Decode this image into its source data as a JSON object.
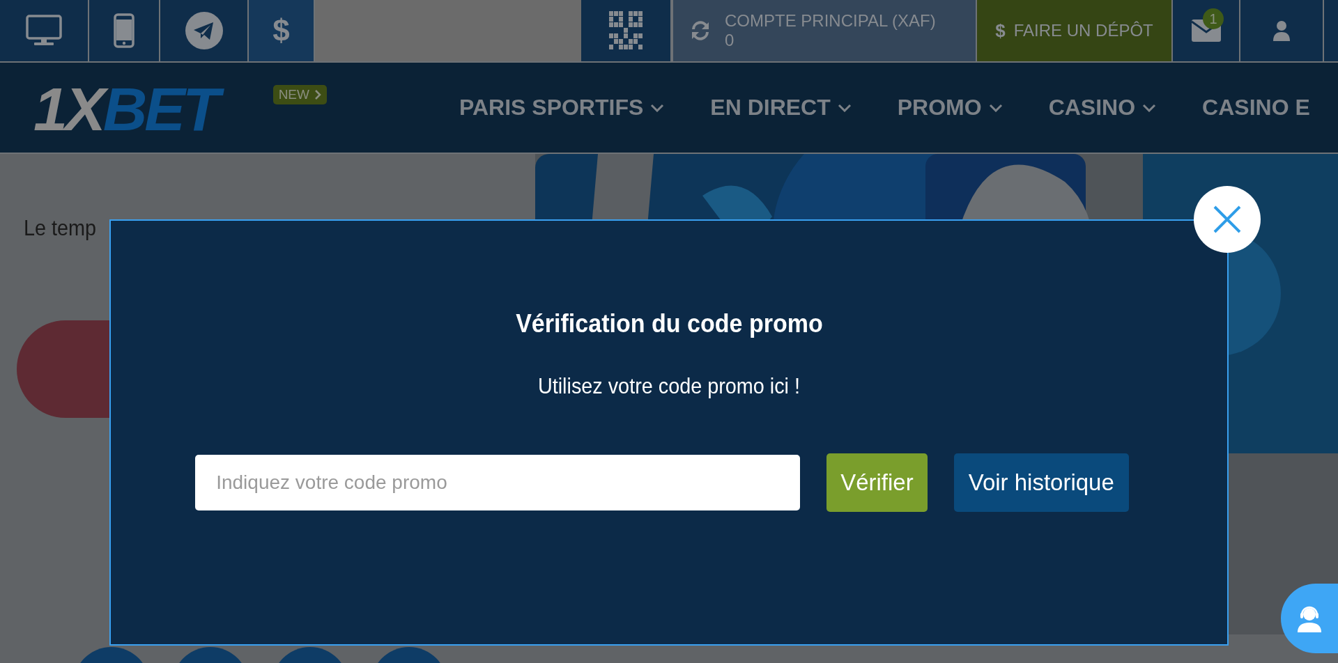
{
  "top_bar": {
    "quick_links": [
      {
        "kind": "desktop",
        "selected": false
      },
      {
        "kind": "mobile",
        "selected": false
      },
      {
        "kind": "telegram",
        "selected": false
      },
      {
        "kind": "currency",
        "label": "$",
        "selected": true
      }
    ],
    "account": {
      "label": "COMPTE PRINCIPAL (XAF)",
      "balance": "0"
    },
    "deposit": {
      "icon": "$",
      "label": "FAIRE UN DÉPÔT"
    },
    "messages": {
      "badge": "1"
    }
  },
  "nav": {
    "logo": [
      "1X",
      "BET"
    ],
    "badge": "NEW",
    "items": [
      "PARIS SPORTIFS",
      "EN DIRECT",
      "PROMO",
      "CASINO",
      "CASINO E"
    ]
  },
  "background": {
    "text": "Le temp"
  },
  "modal": {
    "title": "Vérification du code promo",
    "subtitle": "Utilisez votre code promo ici !",
    "input": {
      "placeholder": "Indiquez votre code promo"
    },
    "buttons": [
      {
        "label": "Vérifier",
        "kind": "primary"
      },
      {
        "label": "Voir historique",
        "kind": "secondary"
      }
    ]
  }
}
